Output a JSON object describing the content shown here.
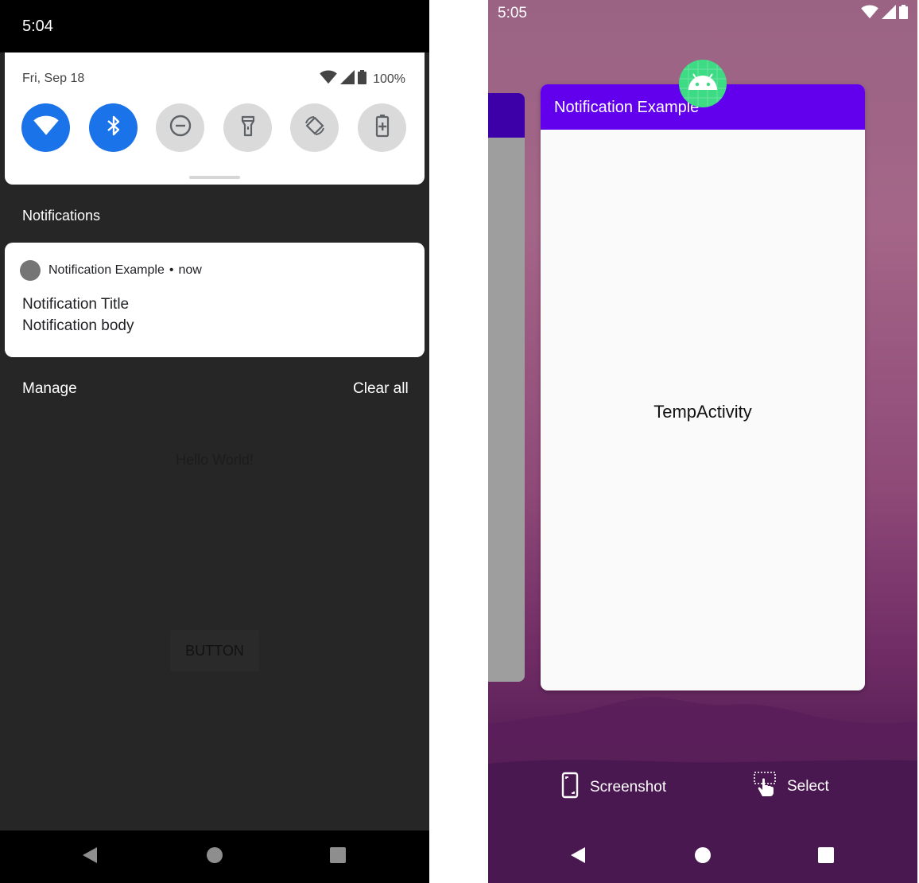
{
  "left_phone": {
    "status_bar": {
      "time": "5:04"
    },
    "quick_settings": {
      "date": "Fri, Sep 18",
      "battery_percent": "100%",
      "tiles": [
        {
          "name": "wifi",
          "state": "on",
          "icon": "wifi-icon"
        },
        {
          "name": "bluetooth",
          "state": "on",
          "icon": "bluetooth-icon"
        },
        {
          "name": "do-not-disturb",
          "state": "off",
          "icon": "do-not-disturb-icon"
        },
        {
          "name": "flashlight",
          "state": "off",
          "icon": "flashlight-icon"
        },
        {
          "name": "auto-rotate",
          "state": "off",
          "icon": "auto-rotate-icon"
        },
        {
          "name": "battery-saver",
          "state": "off",
          "icon": "battery-saver-icon"
        }
      ]
    },
    "notifications_heading": "Notifications",
    "notification": {
      "app_name": "Notification Example",
      "separator": "•",
      "time": "now",
      "title": "Notification Title",
      "body": "Notification body"
    },
    "manage_label": "Manage",
    "clear_all_label": "Clear all",
    "app_background": {
      "hello_text": "Hello World!",
      "button_label": "BUTTON"
    }
  },
  "right_phone": {
    "status_bar": {
      "time": "5:05"
    },
    "recent_card": {
      "app_title": "Notification Example",
      "activity_text": "TempActivity"
    },
    "actions": {
      "screenshot_label": "Screenshot",
      "select_label": "Select"
    }
  },
  "colors": {
    "qs_tile_on": "#1a73e8",
    "qs_tile_off": "#dadada",
    "app_bar": "#6200ee",
    "android_green": "#3ddc84"
  }
}
